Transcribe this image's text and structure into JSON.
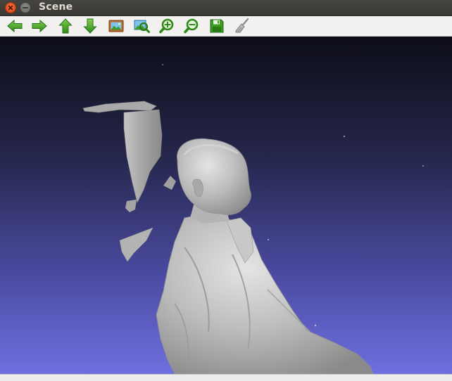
{
  "window": {
    "title": "Scene"
  },
  "titlebar": {
    "buttons": [
      {
        "name": "close-button",
        "icon": "close-icon"
      },
      {
        "name": "minimize-button",
        "icon": "minimize-icon"
      }
    ]
  },
  "toolbar": {
    "tools": [
      {
        "name": "back-button",
        "icon": "arrow-left-icon"
      },
      {
        "name": "forward-button",
        "icon": "arrow-right-icon"
      },
      {
        "name": "up-button",
        "icon": "arrow-up-icon"
      },
      {
        "name": "down-button",
        "icon": "arrow-down-icon"
      },
      {
        "name": "background-image-button",
        "icon": "landscape-picture-icon"
      },
      {
        "name": "fit-view-button",
        "icon": "zoom-fit-icon"
      },
      {
        "name": "zoom-in-button",
        "icon": "zoom-in-icon"
      },
      {
        "name": "zoom-out-button",
        "icon": "zoom-out-icon"
      },
      {
        "name": "save-button",
        "icon": "floppy-disk-icon"
      },
      {
        "name": "clear-button",
        "icon": "broom-icon"
      }
    ]
  },
  "viewport": {
    "content": "3d-scan-render",
    "colors": {
      "gradient_top": "#0d0d18",
      "gradient_bottom": "#6f6fe0",
      "mesh": "#b9b9b9"
    }
  },
  "colors": {
    "titlebar_bg": "#3c3b37",
    "title_text": "#dfdbd2",
    "close_button": "#e95420",
    "toolbar_bg": "#f2f1f0",
    "toolbar_icon_green": "#3d9c1f"
  }
}
